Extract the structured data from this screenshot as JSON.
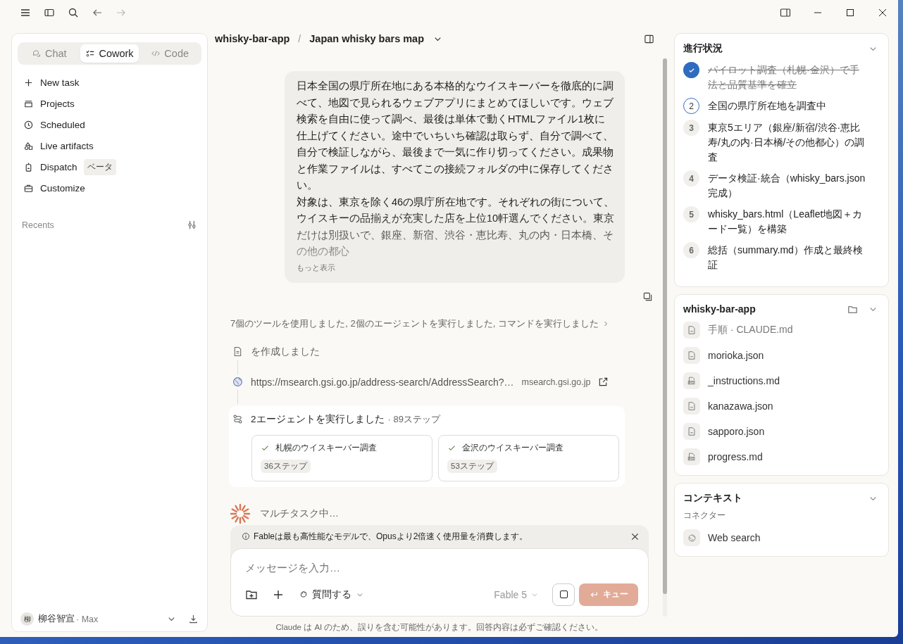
{
  "titlebar": {
    "forward_disabled": true
  },
  "sidebar": {
    "tabs": [
      {
        "label": "Chat",
        "selected": false
      },
      {
        "label": "Cowork",
        "selected": true
      },
      {
        "label": "Code",
        "selected": false
      }
    ],
    "nav": [
      {
        "label": "New task"
      },
      {
        "label": "Projects"
      },
      {
        "label": "Scheduled"
      },
      {
        "label": "Live artifacts"
      },
      {
        "label": "Dispatch",
        "badge": "ベータ"
      },
      {
        "label": "Customize"
      }
    ],
    "recents_label": "Recents",
    "user": {
      "initial": "柳",
      "name": "柳谷智宣",
      "plan": "· Max"
    }
  },
  "header": {
    "project": "whisky-bar-app",
    "separator": "/",
    "task": "Japan whisky bars map"
  },
  "message": {
    "paragraphs": [
      "日本全国の県庁所在地にある本格的なウイスキーバーを徹底的に調べて、地図で見られるウェブアプリにまとめてほしいです。ウェブ検索を自由に使って調べ、最後は単体で動くHTMLファイル1枚に仕上げてください。途中でいちいち確認は取らず、自分で調べて、自分で検証しながら、最後まで一気に作り切ってください。成果物と作業ファイルは、すべてこの接続フォルダの中に保存してください。",
      "対象は、東京を除く46の県庁所在地です。それぞれの街について、ウイスキーの品揃えが充実した店を上位10軒選んでください。東京だけは別扱いで、銀座、新宿、渋谷・恵比寿、丸の内・日本橋、その他の都心"
    ],
    "more": "もっと表示"
  },
  "activity": {
    "summary": "7個のツールを使用しました, 2個のエージェントを実行しました, コマンドを実行しました",
    "steps": [
      {
        "kind": "file",
        "text": "を作成しました"
      },
      {
        "kind": "link",
        "text": "https://msearch.gsi.go.jp/address-search/AddressSearch?…",
        "domain": "msearch.gsi.go.jp"
      }
    ],
    "agents": {
      "title": "2エージェントを実行しました",
      "count": "· 89ステップ",
      "items": [
        {
          "title": "札幌のウイスキーバー調査",
          "steps": "36ステップ",
          "done": true
        },
        {
          "title": "金沢のウイスキーバー調査",
          "steps": "53ステップ",
          "done": true
        }
      ]
    },
    "working": "マルチタスク中…"
  },
  "composer": {
    "notice": "Fableは最も高性能なモデルで、Opusより2倍速く使用量を消費します。",
    "placeholder": "メッセージを入力…",
    "ask": "質問する",
    "model": "Fable 5",
    "queue": "キュー",
    "queue_disabled": true,
    "disclaimer": "Claude は AI のため、誤りを含む可能性があります。回答内容は必ずご確認ください。"
  },
  "progress": {
    "title": "進行状況",
    "expanded": true,
    "steps": [
      {
        "text": "パイロット調査（札幌·金沢）で手法と品質基準を確立",
        "done": true,
        "active": false
      },
      {
        "number": "2",
        "text": "全国の県庁所在地を調査中",
        "done": false,
        "active": true
      },
      {
        "number": "3",
        "text": "東京5エリア（銀座/新宿/渋谷·恵比寿/丸の内·日本橋/その他都心）の調査",
        "done": false,
        "active": false
      },
      {
        "number": "4",
        "text": "データ検証·統合（whisky_bars.json 完成）",
        "done": false,
        "active": false
      },
      {
        "number": "5",
        "text": "whisky_bars.html（Leaflet地図＋カード一覧）を構築",
        "done": false,
        "active": false
      },
      {
        "number": "6",
        "text": "総括（summary.md）作成と最終検証",
        "done": false,
        "active": false
      }
    ]
  },
  "folder": {
    "title": "whisky-bar-app",
    "expanded": true,
    "files": [
      {
        "name": "手順 · CLAUDE.md",
        "kind": "doc",
        "muted": true
      },
      {
        "name": "morioka.json",
        "kind": "doc",
        "muted": false
      },
      {
        "name": "_instructions.md",
        "kind": "md",
        "muted": false
      },
      {
        "name": "kanazawa.json",
        "kind": "doc",
        "muted": false
      },
      {
        "name": "sapporo.json",
        "kind": "doc",
        "muted": false
      },
      {
        "name": "progress.md",
        "kind": "md",
        "muted": false
      }
    ]
  },
  "context": {
    "title": "コンテキスト",
    "expanded": true,
    "section": "コネクター",
    "connectors": [
      {
        "name": "Web search"
      }
    ]
  }
}
